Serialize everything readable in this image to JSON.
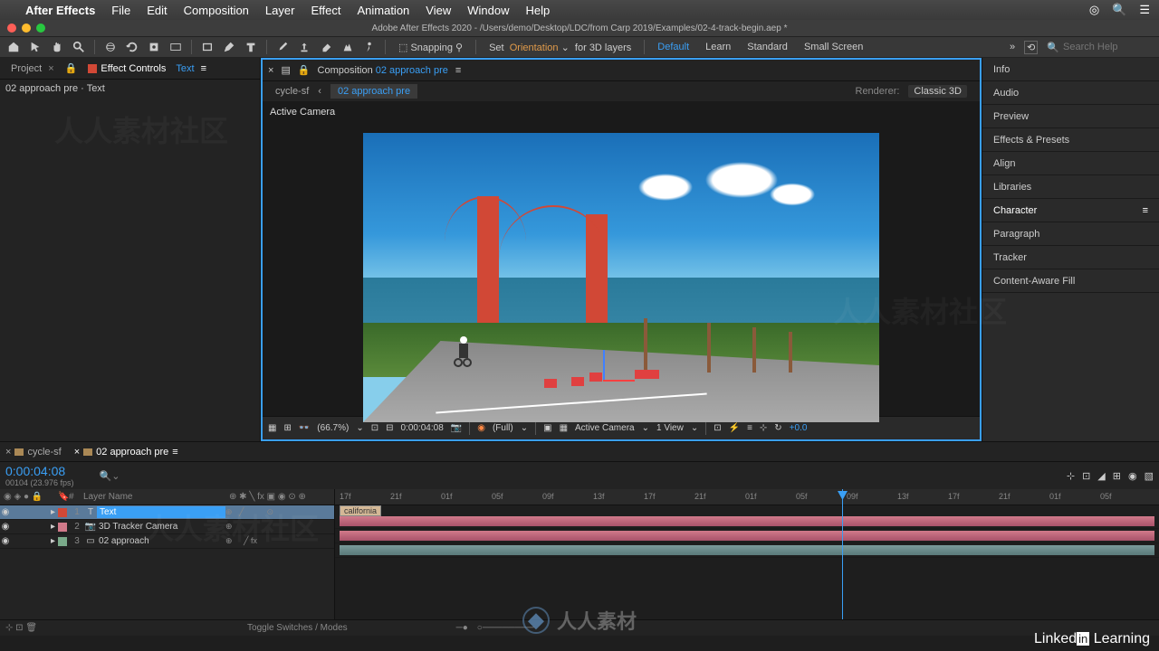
{
  "menubar": {
    "appname": "After Effects",
    "items": [
      "File",
      "Edit",
      "Composition",
      "Layer",
      "Effect",
      "Animation",
      "View",
      "Window",
      "Help"
    ]
  },
  "titlebar": "Adobe After Effects 2020 - /Users/demo/Desktop/LDC/from Carp 2019/Examples/02-4-track-begin.aep *",
  "toolbar": {
    "snap": "Snapping",
    "set_label": "Set",
    "orient": "Orientation",
    "for3d": "for 3D layers",
    "workspaces": [
      "Default",
      "Learn",
      "Standard",
      "Small Screen"
    ],
    "search_placeholder": "Search Help"
  },
  "left_panel": {
    "tab1": "Project",
    "tab2_prefix": "Effect Controls",
    "tab2_target": "Text",
    "content": "02 approach pre · Text"
  },
  "comp_panel": {
    "prefix": "Composition",
    "name": "02 approach pre",
    "crumb1": "cycle-sf",
    "crumb2": "02 approach pre",
    "renderer_label": "Renderer:",
    "renderer_value": "Classic 3D",
    "active_camera": "Active Camera"
  },
  "viewer_footer": {
    "mag": "(66.7%)",
    "time": "0:00:04:08",
    "res": "(Full)",
    "camera": "Active Camera",
    "view": "1 View",
    "exposure": "+0.0"
  },
  "right_panel": {
    "items": [
      "Info",
      "Audio",
      "Preview",
      "Effects & Presets",
      "Align",
      "Libraries",
      "Character",
      "Paragraph",
      "Tracker",
      "Content-Aware Fill"
    ],
    "selected": "Character"
  },
  "timeline": {
    "tab1": "cycle-sf",
    "tab2": "02 approach pre",
    "timecode": "0:00:04:08",
    "timecode_sub": "00104 (23.976 fps)",
    "col_layer": "Layer Name",
    "marker": "california",
    "layers": [
      {
        "num": "1",
        "name": "Text",
        "type": "T",
        "swatch": "sw1",
        "selected": true
      },
      {
        "num": "2",
        "name": "3D Tracker Camera",
        "type": "cam",
        "swatch": "sw2",
        "selected": false
      },
      {
        "num": "3",
        "name": "02 approach",
        "type": "vid",
        "swatch": "sw3",
        "selected": false
      }
    ],
    "ticks": [
      "17f",
      "21f",
      "01f",
      "05f",
      "09f",
      "13f",
      "17f",
      "21f",
      "01f",
      "05f",
      "09f",
      "13f",
      "17f",
      "21f",
      "01f",
      "05f"
    ]
  },
  "status": {
    "toggle": "Toggle Switches / Modes"
  },
  "branding": {
    "linkedin": "Linked",
    "in": "in",
    "learning": "Learning",
    "footer": "人人素材"
  }
}
